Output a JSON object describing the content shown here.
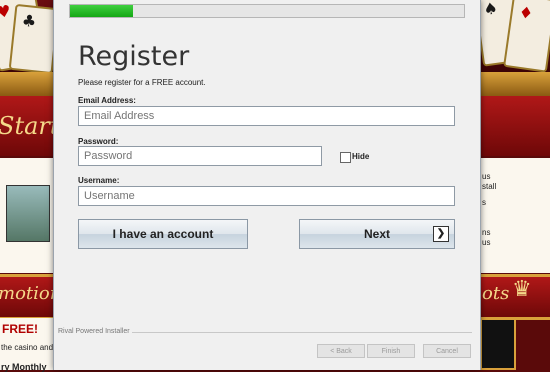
{
  "background": {
    "slogan_left": "Start You",
    "banner_left": "motions",
    "banner_right": "ots",
    "free_text": "FREE!",
    "body_left_1": "the casino and g",
    "body_left_2": "ry Monthly",
    "side_right_1": "us",
    "side_right_2": "stall",
    "side_right_3": "s",
    "side_right_4": "ns",
    "side_right_5": "us"
  },
  "installer": {
    "progress_percent": 16,
    "title": "Register",
    "subtitle": "Please register for a FREE account.",
    "email_label": "Email Address:",
    "email_placeholder": "Email Address",
    "password_label": "Password:",
    "password_placeholder": "Password",
    "hide_label": "Hide",
    "username_label": "Username:",
    "username_placeholder": "Username",
    "have_account_label": "I have an account",
    "next_label": "Next",
    "next_icon": "chevron-right-icon",
    "brand_footer": "Rival Powered Installer",
    "back_label": "< Back",
    "finish_label": "Finish",
    "cancel_label": "Cancel"
  }
}
